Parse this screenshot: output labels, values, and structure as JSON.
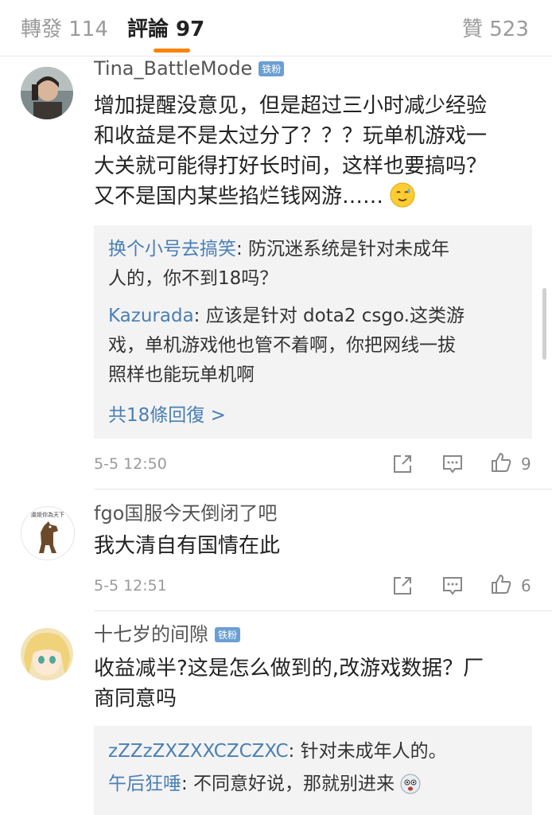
{
  "tabs": {
    "reposts": "轉發 114",
    "comments": "評論 97",
    "likes": "贊 523",
    "accent_color": "#ff8200"
  },
  "comments": [
    {
      "username": "Tina_BattleMode",
      "badge": "铁粉",
      "lines": [
        "增加提醒没意见，但是超过三小时减少经验",
        "和收益是不是太过分了？？？玩单机游戏一",
        "大关就可能得打好长时间，这样也要搞吗？",
        "又不是国内某些掐烂钱网游……"
      ],
      "emoji": "sweat-smile-emoji",
      "replies": [
        {
          "name": "换个小号去搞笑",
          "lines": [
            ": 防沉迷系统是针对未成年",
            "人的，你不到18吗？"
          ]
        },
        {
          "name": "Kazurada",
          "lines": [
            ": 应该是针对 dota2  csgo.这类游",
            "戏，单机游戏他也管不着啊，你把网线一拔",
            "照样也能玩单机啊"
          ]
        }
      ],
      "more_replies": "共18條回復 >",
      "time": "5-5 12:50",
      "likes": "9"
    },
    {
      "username": "fgo国服今天倒闭了吧",
      "avatar_caption": "虞姬你為天下",
      "lines": [
        "我大清自有国情在此"
      ],
      "time": "5-5 12:51",
      "likes": "6"
    },
    {
      "username": "十七岁的间隙",
      "badge": "铁粉",
      "lines": [
        "收益减半?这是怎么做到的,改游戏数据？厂",
        "商同意吗"
      ],
      "replies": [
        {
          "name": "zZZzZXZXXCZCZXC",
          "lines": [
            ": 针对未成年人的。"
          ]
        },
        {
          "name": "午后狂唾",
          "lines": [
            ": 不同意好说，那就别进来"
          ]
        }
      ]
    }
  ]
}
